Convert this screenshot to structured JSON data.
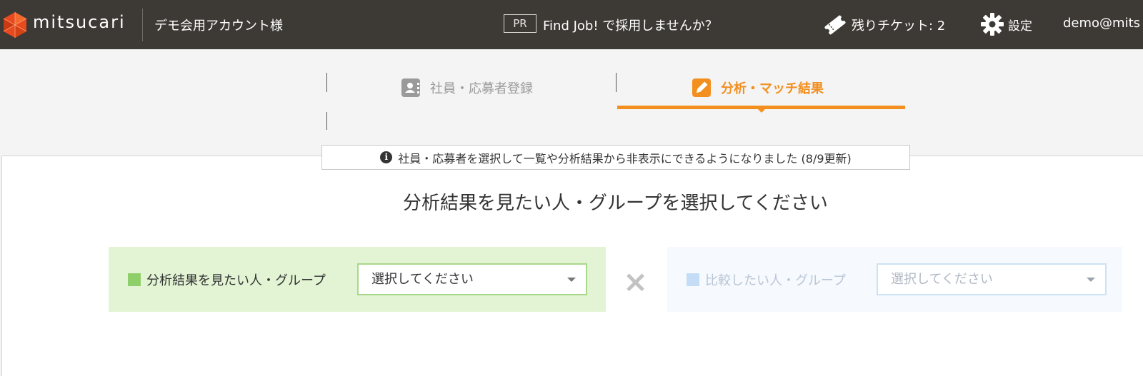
{
  "header": {
    "logo_text": "mitsucari",
    "account_name": "デモ会用アカウント様",
    "pr_badge": "PR",
    "findjob_text": "Find Job! で採用しませんか？",
    "tickets_text": "残りチケット: 2",
    "settings_label": "設定",
    "user_email": "demo@mits"
  },
  "tabs": [
    {
      "label": "社員・応募者登録",
      "active": false
    },
    {
      "label": "分析・マッチ結果",
      "active": true
    }
  ],
  "notice": {
    "icon": "info-icon",
    "text": "社員・応募者を選択して一覧や分析結果から非表示にできるようになりました (8/9更新)"
  },
  "main": {
    "heading": "分析結果を見たい人・グループを選択してください",
    "target_group": {
      "label": "分析結果を見たい人・グループ",
      "select_value": "選択してください"
    },
    "compare_group": {
      "label": "比較したい人・グループ",
      "select_value": "選択してください"
    }
  },
  "colors": {
    "header_bg": "#3d3935",
    "accent": "#f28f1f",
    "target_bg": "#e3f4d4",
    "compare_bg": "#f6f9fd"
  }
}
